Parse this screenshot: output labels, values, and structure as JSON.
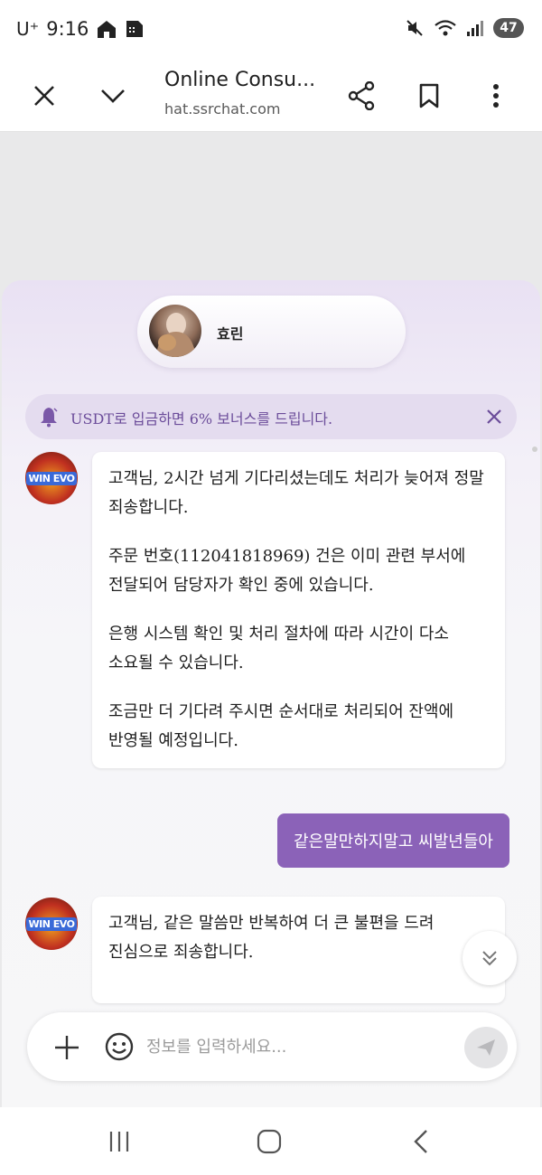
{
  "status_bar": {
    "carrier": "U⁺",
    "time": "9:16",
    "battery": "47"
  },
  "browser": {
    "title": "Online Consu...",
    "url": "hat.ssrchat.com"
  },
  "chat": {
    "agent_name": "효린",
    "notice": "USDT로 입금하면 6% 보너스를 드립니다.",
    "bot_logo_text": "WIN EVO",
    "messages": [
      {
        "from": "bot",
        "paragraphs": [
          "고객님, 2시간 넘게 기다리셨는데도 처리가 늦어져 정말 죄송합니다.",
          "주문 번호(112041818969) 건은 이미 관련 부서에 전달되어 담당자가 확인 중에 있습니다.",
          "은행 시스템 확인 및 처리 절차에 따라 시간이 다소 소요될 수 있습니다.",
          "조금만 더 기다려 주시면 순서대로 처리되어 잔액에 반영될 예정입니다."
        ]
      },
      {
        "from": "user",
        "text": "같은말만하지말고 씨발년들아"
      },
      {
        "from": "bot",
        "paragraphs": [
          "고객님, 같은 말씀만 반복하여 더 큰 불편을 드려 진심으로 죄송합니다."
        ]
      }
    ],
    "input": {
      "placeholder": "정보를 입력하세요...",
      "value": ""
    }
  },
  "colors": {
    "accent": "#8b62b8",
    "notice_bg": "#e4dcef",
    "notice_text": "#6b4c9a"
  },
  "icons": [
    "close-icon",
    "chevron-down-icon",
    "share-icon",
    "bookmark-icon",
    "more-vert-icon",
    "bell-icon",
    "plus-icon",
    "emoji-icon",
    "send-icon",
    "double-chevron-down-icon",
    "recents-icon",
    "home-icon",
    "back-icon"
  ]
}
